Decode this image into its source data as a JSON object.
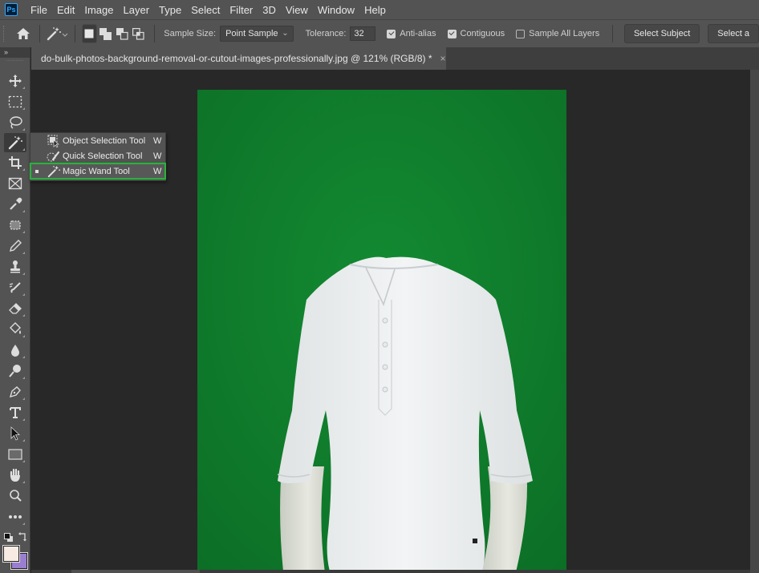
{
  "app": {
    "logo_text": "Ps"
  },
  "menubar": {
    "items": [
      "File",
      "Edit",
      "Image",
      "Layer",
      "Type",
      "Select",
      "Filter",
      "3D",
      "View",
      "Window",
      "Help"
    ]
  },
  "options_bar": {
    "home_icon": "home-icon",
    "tool_preset_icon": "magic-wand-icon",
    "selection_modes": [
      {
        "name": "new-selection",
        "active": true
      },
      {
        "name": "add-to-selection",
        "active": false
      },
      {
        "name": "subtract-from-selection",
        "active": false
      },
      {
        "name": "intersect-with-selection",
        "active": false
      }
    ],
    "sample_size_label": "Sample Size:",
    "sample_size_value": "Point Sample",
    "tolerance_label": "Tolerance:",
    "tolerance_value": "32",
    "anti_alias_label": "Anti-alias",
    "anti_alias_checked": true,
    "contiguous_label": "Contiguous",
    "contiguous_checked": true,
    "sample_all_layers_label": "Sample All Layers",
    "sample_all_layers_checked": false,
    "select_subject_label": "Select Subject",
    "select_and_mask_label": "Select a"
  },
  "toolbar": {
    "expand_label": "»",
    "tools": [
      {
        "name": "move-tool",
        "icon": "move-icon"
      },
      {
        "name": "rectangular-marquee-tool",
        "icon": "marquee-icon"
      },
      {
        "name": "lasso-tool",
        "icon": "lasso-icon"
      },
      {
        "name": "magic-wand-tool",
        "icon": "magic-wand-icon",
        "active": true
      },
      {
        "name": "crop-tool",
        "icon": "crop-icon"
      },
      {
        "name": "frame-tool",
        "icon": "frame-icon"
      },
      {
        "name": "eyedropper-tool",
        "icon": "eyedropper-icon"
      },
      {
        "name": "spot-healing-tool",
        "icon": "healing-icon"
      },
      {
        "name": "brush-tool",
        "icon": "brush-icon"
      },
      {
        "name": "clone-stamp-tool",
        "icon": "stamp-icon"
      },
      {
        "name": "history-brush-tool",
        "icon": "history-brush-icon"
      },
      {
        "name": "eraser-tool",
        "icon": "eraser-icon"
      },
      {
        "name": "paint-bucket-tool",
        "icon": "paint-bucket-icon"
      },
      {
        "name": "blur-tool",
        "icon": "blur-drop-icon"
      },
      {
        "name": "dodge-tool",
        "icon": "dodge-icon"
      },
      {
        "name": "pen-tool",
        "icon": "pen-icon"
      },
      {
        "name": "type-tool",
        "icon": "type-icon"
      },
      {
        "name": "path-selection-tool",
        "icon": "arrow-icon"
      },
      {
        "name": "rectangle-tool",
        "icon": "rectangle-icon"
      },
      {
        "name": "hand-tool",
        "icon": "hand-icon"
      },
      {
        "name": "zoom-tool",
        "icon": "zoom-icon"
      },
      {
        "name": "edit-toolbar",
        "icon": "more-icon"
      }
    ],
    "foreground_color": "#f7ebe3",
    "background_color": "#9a7fd0"
  },
  "document": {
    "tab_title": "do-bulk-photos-background-removal-or-cutout-images-professionally.jpg @ 121% (RGB/8) *",
    "close_label": "×",
    "background_color": "#0f7a2a"
  },
  "flyout": {
    "items": [
      {
        "label": "Object Selection Tool",
        "shortcut": "W",
        "icon": "object-selection-icon",
        "selected": false
      },
      {
        "label": "Quick Selection Tool",
        "shortcut": "W",
        "icon": "quick-selection-icon",
        "selected": false
      },
      {
        "label": "Magic Wand Tool",
        "shortcut": "W",
        "icon": "magic-wand-icon",
        "selected": true
      }
    ],
    "highlight_color": "#27b43a"
  }
}
